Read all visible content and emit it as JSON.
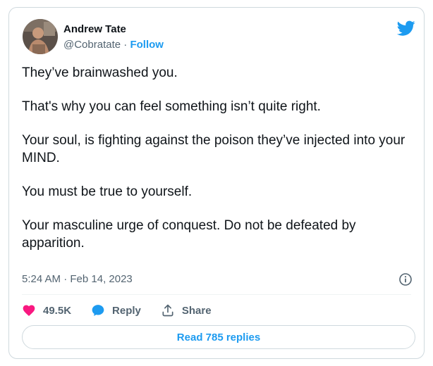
{
  "author": {
    "name": "Andrew Tate",
    "handle": "@Cobratate",
    "separator": "·",
    "follow_label": "Follow"
  },
  "tweet": {
    "paragraphs": [
      "They’ve brainwashed you.",
      "That's why you can feel something isn’t quite right.",
      "Your soul, is fighting against the poison they’ve injected into your MIND.",
      "You must be true to yourself.",
      "Your masculine urge of conquest. Do not be defeated by apparition."
    ],
    "timestamp": "5:24 AM · Feb 14, 2023"
  },
  "actions": {
    "like_count": "49.5K",
    "reply_label": "Reply",
    "share_label": "Share"
  },
  "read_replies_label": "Read 785 replies",
  "icons": {
    "logo": "twitter-bird-icon",
    "like": "heart-icon",
    "reply": "speech-bubble-icon",
    "share": "share-upload-icon",
    "info": "info-icon"
  },
  "colors": {
    "brand_blue": "#1d9bf0",
    "like_pink": "#f91880",
    "text_primary": "#0f1419",
    "text_secondary": "#536471",
    "border": "#cfd9de"
  }
}
